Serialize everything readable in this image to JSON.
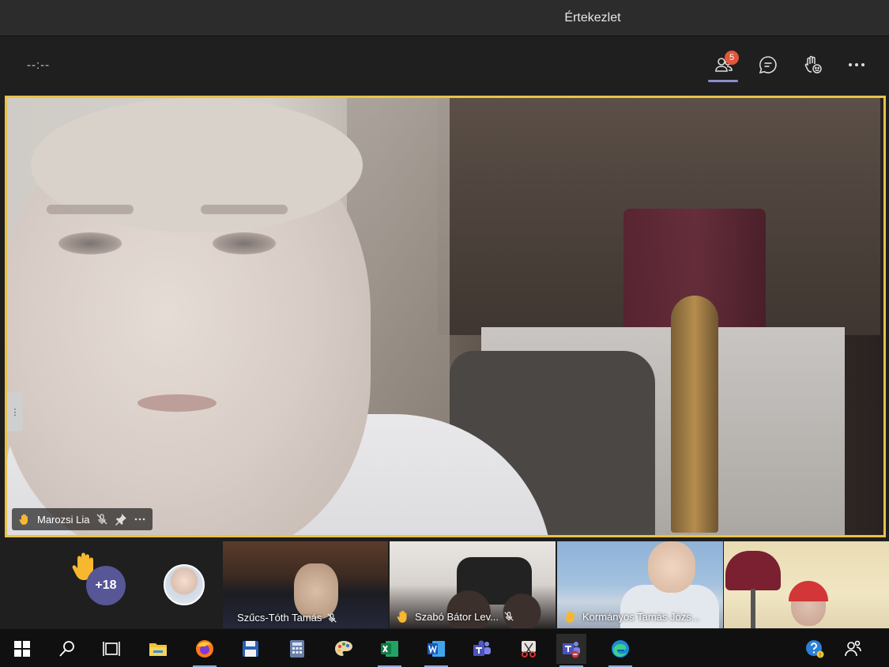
{
  "window": {
    "title": "Értekezlet"
  },
  "header": {
    "timer": "--:--",
    "participants_icon": "participants-icon",
    "participants_badge": "5",
    "chat_icon": "chat-icon",
    "reactions_icon": "raise-hand-reactions-icon",
    "more_icon": "more-options-icon"
  },
  "main_video": {
    "participant_name": "Marozsi Lia",
    "hand_raised": true,
    "muted": true,
    "accent_color": "#e9c24a"
  },
  "gallery": {
    "overflow_count": "+18",
    "tiles": [
      {
        "name": "Szűcs-Tóth Tamás",
        "hand_raised": false,
        "muted": true
      },
      {
        "name": "Szabó Bátor Lev...",
        "hand_raised": true,
        "muted": true
      },
      {
        "name": "Kormányos Tamás Józs...",
        "hand_raised": true,
        "muted": false
      },
      {
        "name": "",
        "hand_raised": false,
        "muted": false
      }
    ]
  },
  "taskbar": {
    "apps": [
      "windows-start-icon",
      "search-icon",
      "task-view-icon",
      "file-explorer-icon",
      "firefox-icon",
      "save-app-icon",
      "calculator-icon",
      "paint-icon",
      "excel-icon",
      "word-icon",
      "teams-icon",
      "snipping-tool-icon",
      "teams-meeting-icon",
      "edge-icon"
    ],
    "tray": [
      "help-icon",
      "people-icon"
    ]
  }
}
